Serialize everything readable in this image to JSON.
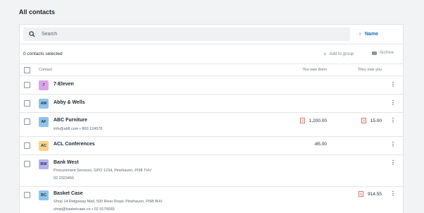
{
  "page": {
    "title": "All contacts"
  },
  "search": {
    "placeholder": "Search"
  },
  "sort": {
    "label": "Name",
    "arrow": "↑"
  },
  "selection": {
    "count_text": "0 contacts selected"
  },
  "actions": {
    "add_to_group": "Add to group",
    "archive": "Archive"
  },
  "columns": {
    "contact": "Contact",
    "you_owe": "You owe them",
    "they_owe": "They owe you"
  },
  "contacts": [
    {
      "avatar": "7",
      "avatar_color": "#d9a5e6",
      "name": "7-Eleven"
    },
    {
      "avatar": "AW",
      "avatar_color": "#8ec4ec",
      "name": "Abby & Wells"
    },
    {
      "avatar": "AF",
      "avatar_color": "#8ec4ec",
      "name": "ABC Furniture",
      "detail": "info@abfl.com  •  800.124578",
      "you_owe": "1,200.00",
      "they_owe": "15.00"
    },
    {
      "avatar": "AC",
      "avatar_color": "#f6d48a",
      "name": "ACL Conferences",
      "you_owe": "-85.00"
    },
    {
      "avatar": "BW",
      "avatar_color": "#b7b1ef",
      "name": "Bank West",
      "detail": "Procurement Services, GPO 1234, Pinehaven, PI98 THV",
      "detail2": "02 2023456"
    },
    {
      "avatar": "BC",
      "avatar_color": "#8ec4ec",
      "name": "Basket Case",
      "detail": "Shop 14 Ridgeway Mall, 500 River Road, Pinehaven, PI98 8HV",
      "detail2": "shop@basketcase.co  •  02 9176665",
      "they_owe": "914.55"
    }
  ],
  "icons": {
    "search": "search-icon",
    "more": "more-vertical-icon",
    "pdf": "pdf-invoice-icon",
    "add": "plus-icon",
    "archive": "archive-icon"
  }
}
